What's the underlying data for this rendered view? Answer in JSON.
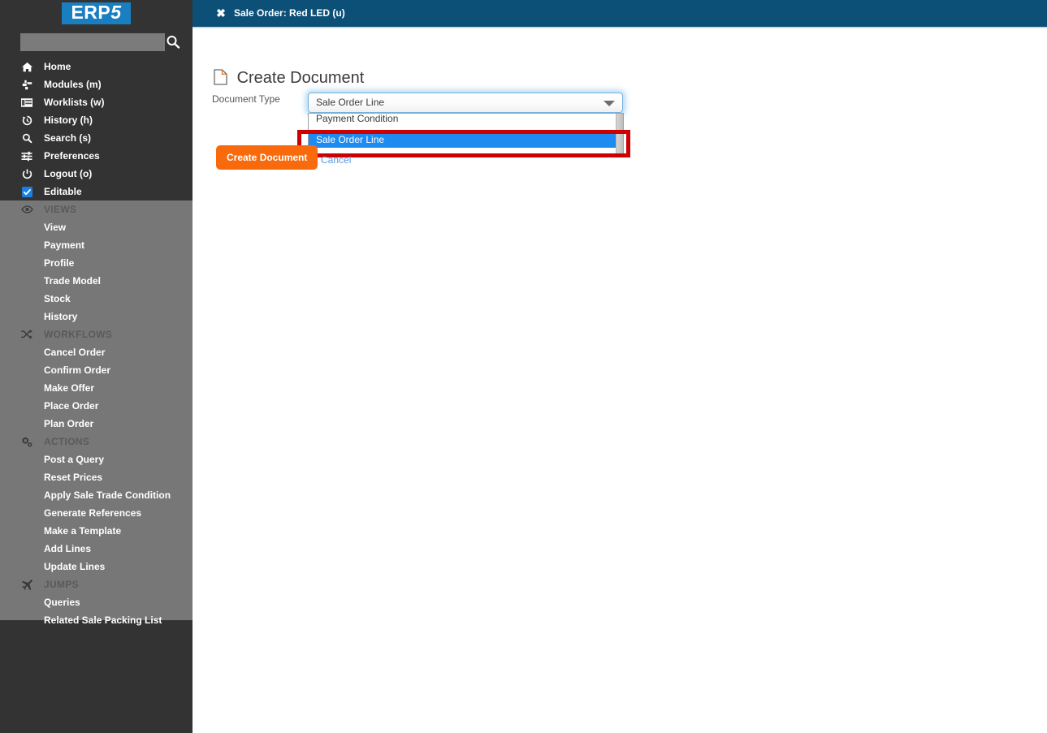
{
  "brand": {
    "logo_text": "ERP",
    "logo_suffix": "5",
    "logo_bg": "#1a7fc1"
  },
  "sidebar": {
    "search": {
      "value": "",
      "placeholder": "",
      "icon": "search-icon"
    },
    "nav_items": [
      {
        "label": "Home",
        "icon": "home-icon"
      },
      {
        "label": "Modules (m)",
        "icon": "modules-icon"
      },
      {
        "label": "Worklists (w)",
        "icon": "worklists-icon"
      },
      {
        "label": "History (h)",
        "icon": "history-icon"
      },
      {
        "label": "Search (s)",
        "icon": "search-icon"
      },
      {
        "label": "Preferences",
        "icon": "sliders-icon"
      },
      {
        "label": "Logout (o)",
        "icon": "power-icon"
      },
      {
        "label": "Editable",
        "icon": "checkbox-checked-icon"
      }
    ],
    "sections": [
      {
        "title": "VIEWS",
        "icon": "eye-icon",
        "items": [
          "View",
          "Payment",
          "Profile",
          "Trade Model",
          "Stock",
          "History"
        ]
      },
      {
        "title": "WORKFLOWS",
        "icon": "shuffle-icon",
        "items": [
          "Cancel Order",
          "Confirm Order",
          "Make Offer",
          "Place Order",
          "Plan Order"
        ]
      },
      {
        "title": "ACTIONS",
        "icon": "gears-icon",
        "items": [
          "Post a Query",
          "Reset Prices",
          "Apply Sale Trade Condition",
          "Generate References",
          "Make a Template",
          "Add Lines",
          "Update Lines"
        ]
      },
      {
        "title": "JUMPS",
        "icon": "plane-icon",
        "items": [
          "Queries",
          "Related Sale Packing List"
        ]
      }
    ]
  },
  "header": {
    "close_icon": "close-icon",
    "close_glyph": "✖",
    "title": "Sale Order: Red LED (u)",
    "bg": "#0c5078"
  },
  "main": {
    "page_title": "Create Document",
    "page_icon": "document-icon",
    "form": {
      "field_label": "Document Type",
      "select": {
        "value": "Sale Order Line",
        "expanded": true,
        "options": [
          "Payment Condition",
          "Sale Order Line"
        ],
        "selected_index": 1,
        "highlight_color": "#cc0000",
        "option_highlight_bg": "#1e8bf0"
      }
    },
    "actions": {
      "create_label": "Create Document",
      "create_color": "#f96a0d",
      "cancel_label": "Cancel",
      "cancel_color": "#5a9bd5"
    }
  }
}
